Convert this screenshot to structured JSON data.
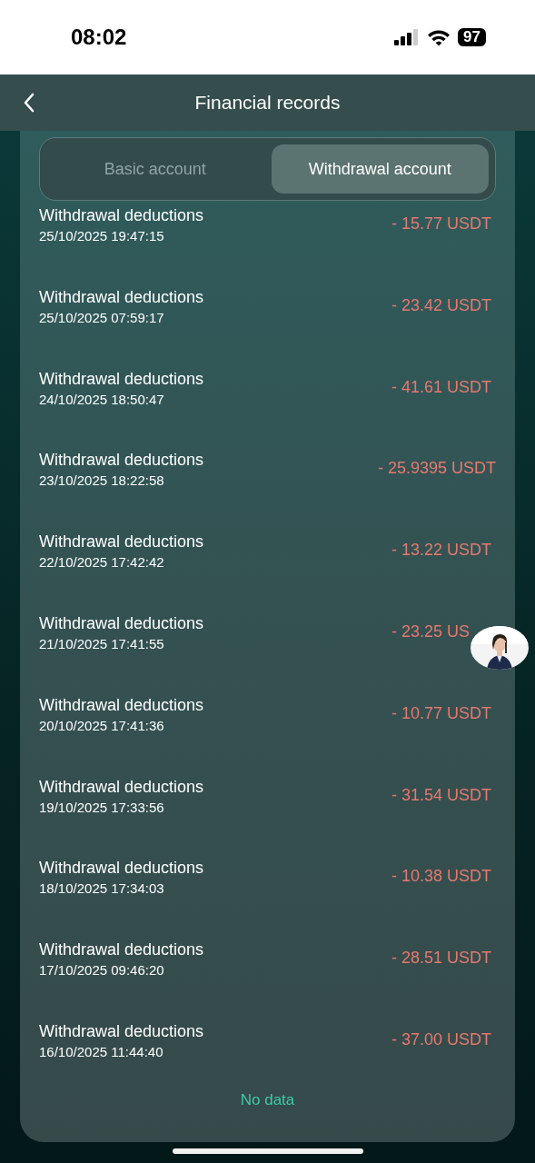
{
  "status_bar": {
    "time": "08:02",
    "battery": "97"
  },
  "header": {
    "title": "Financial records"
  },
  "tabs": [
    {
      "label": "Basic account",
      "selected": false
    },
    {
      "label": "Withdrawal account",
      "selected": true
    }
  ],
  "records": [
    {
      "title": "Withdrawal deductions",
      "date": "25/10/2025 19:47:15",
      "amount": "- 15.77 USDT"
    },
    {
      "title": "Withdrawal deductions",
      "date": "25/10/2025 07:59:17",
      "amount": "- 23.42 USDT"
    },
    {
      "title": "Withdrawal deductions",
      "date": "24/10/2025 18:50:47",
      "amount": "- 41.61 USDT"
    },
    {
      "title": "Withdrawal deductions",
      "date": "23/10/2025 18:22:58",
      "amount": "- 25.9395 USDT"
    },
    {
      "title": "Withdrawal deductions",
      "date": "22/10/2025 17:42:42",
      "amount": "- 13.22 USDT"
    },
    {
      "title": "Withdrawal deductions",
      "date": "21/10/2025 17:41:55",
      "amount": "- 23.25 US"
    },
    {
      "title": "Withdrawal deductions",
      "date": "20/10/2025 17:41:36",
      "amount": "- 10.77 USDT"
    },
    {
      "title": "Withdrawal deductions",
      "date": "19/10/2025 17:33:56",
      "amount": "- 31.54 USDT"
    },
    {
      "title": "Withdrawal deductions",
      "date": "18/10/2025 17:34:03",
      "amount": "- 10.38 USDT"
    },
    {
      "title": "Withdrawal deductions",
      "date": "17/10/2025 09:46:20",
      "amount": "- 28.51 USDT"
    },
    {
      "title": "Withdrawal deductions",
      "date": "16/10/2025 11:44:40",
      "amount": "- 37.00 USDT"
    }
  ],
  "empty_note": "No data"
}
